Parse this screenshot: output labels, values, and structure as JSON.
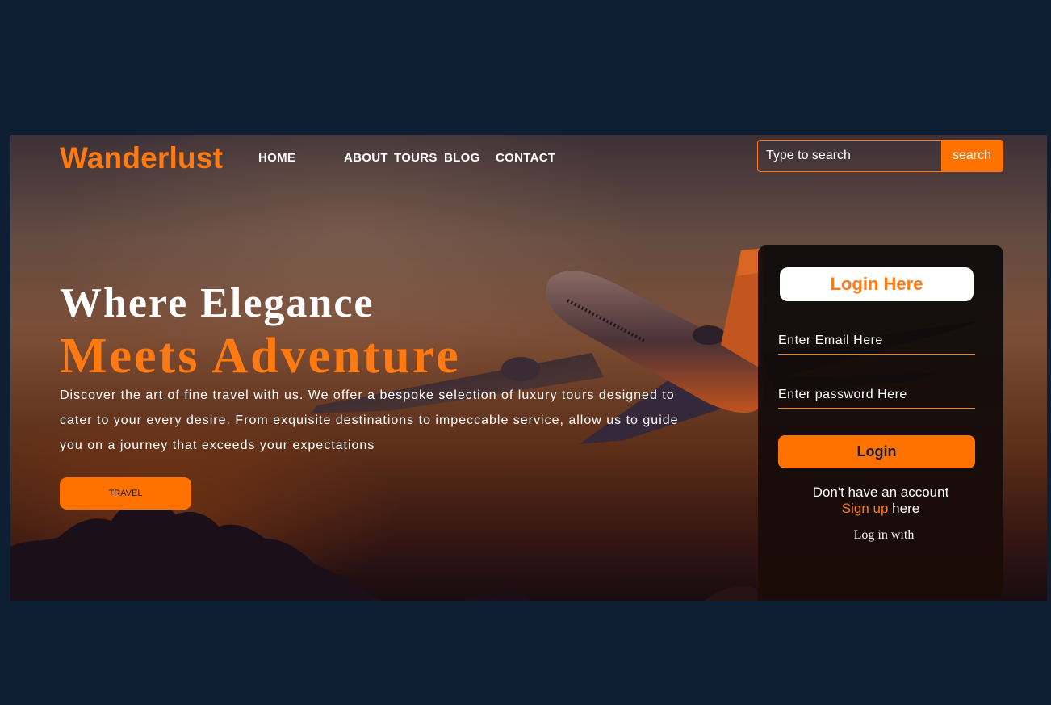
{
  "brand": {
    "logo": "Wanderlust"
  },
  "nav": {
    "items": [
      {
        "label": "HOME"
      },
      {
        "label": "ABOUT"
      },
      {
        "label": "TOURS"
      },
      {
        "label": "BLOG"
      },
      {
        "label": "CONTACT"
      }
    ]
  },
  "search": {
    "placeholder": "Type to search",
    "button_label": "search"
  },
  "hero": {
    "headline_line1": "Where Elegance",
    "headline_line2": "Meets Adventure",
    "description": "Discover the art of fine travel with us. We offer a bespoke selection of luxury tours designed to cater to your every desire. From exquisite destinations to impeccable service, allow us to guide you on a journey that exceeds your expectations",
    "cta_label": "TRAVEL"
  },
  "login": {
    "title": "Login Here",
    "email_placeholder": "Enter Email Here",
    "password_placeholder": "Enter password Here",
    "button_label": "Login",
    "no_account_text": "Don't have an account",
    "signup_link": "Sign up",
    "signup_suffix": " here",
    "log_in_with": "Log in with"
  },
  "colors": {
    "accent": "#ff7200",
    "page_background": "#0e1e33",
    "text": "#ffffff"
  }
}
